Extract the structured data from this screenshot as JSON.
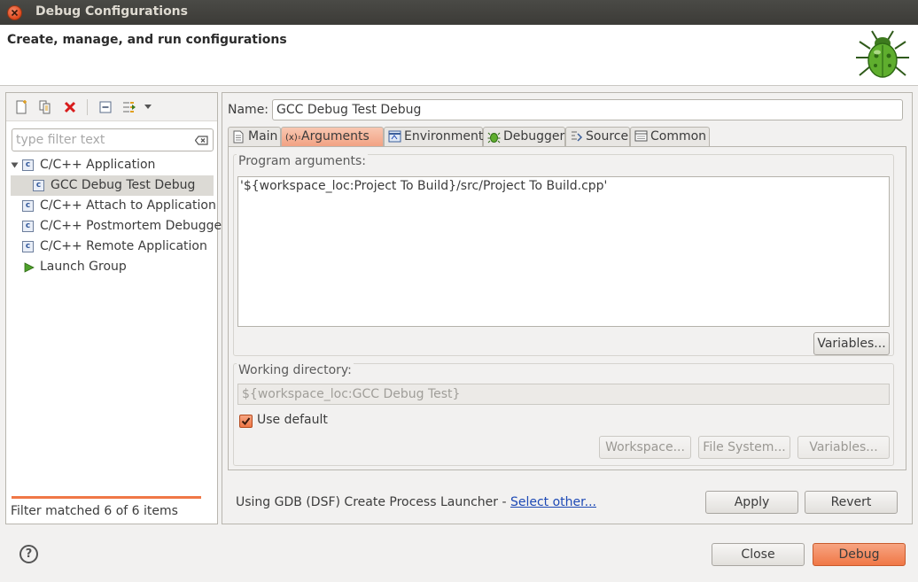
{
  "window": {
    "title": "Debug Configurations"
  },
  "banner": {
    "title": "Create, manage, and run configurations",
    "icon": "bug-icon"
  },
  "left_panel": {
    "toolbar": [
      "new-config-icon",
      "duplicate-icon",
      "delete-icon",
      "collapse-all-icon",
      "filter-icon",
      "dropdown-icon"
    ],
    "filter_placeholder": "type filter text",
    "tree": [
      {
        "label": "C/C++ Application",
        "level": 0,
        "expanded": true
      },
      {
        "label": "GCC Debug Test Debug",
        "level": 1,
        "selected": true
      },
      {
        "label": "C/C++ Attach to Application",
        "level": 0
      },
      {
        "label": "C/C++ Postmortem Debugger",
        "level": 0
      },
      {
        "label": "C/C++ Remote Application",
        "level": 0
      },
      {
        "label": "Launch Group",
        "level": 0
      }
    ],
    "status": "Filter matched 6 of 6 items"
  },
  "config": {
    "name_label": "Name:",
    "name_value": "GCC Debug Test Debug",
    "tabs": [
      {
        "label": "Main",
        "icon": "main-tab-icon"
      },
      {
        "label": "Arguments",
        "icon": "arguments-tab-icon",
        "active": true
      },
      {
        "label": "Environment",
        "icon": "environment-tab-icon"
      },
      {
        "label": "Debugger",
        "icon": "debugger-tab-icon"
      },
      {
        "label": "Source",
        "icon": "source-tab-icon"
      },
      {
        "label": "Common",
        "icon": "common-tab-icon"
      }
    ],
    "program_args_label": "Program arguments:",
    "program_args_value": "'${workspace_loc:Project To Build}/src/Project To Build.cpp'",
    "variables_label": "Variables...",
    "working_dir_label": "Working directory:",
    "working_dir_value": "${workspace_loc:GCC Debug Test}",
    "use_default_label": "Use default",
    "use_default_checked": true,
    "workspace_label": "Workspace...",
    "file_system_label": "File System...",
    "variables2_label": "Variables..."
  },
  "launcher": {
    "text": "Using GDB (DSF) Create Process Launcher - ",
    "link": "Select other..."
  },
  "actions": {
    "apply": "Apply",
    "revert": "Revert",
    "close": "Close",
    "debug": "Debug",
    "help": "?"
  },
  "colors": {
    "accent": "#f07746",
    "link": "#1d49b5",
    "titlebar": "#3c3b37"
  }
}
